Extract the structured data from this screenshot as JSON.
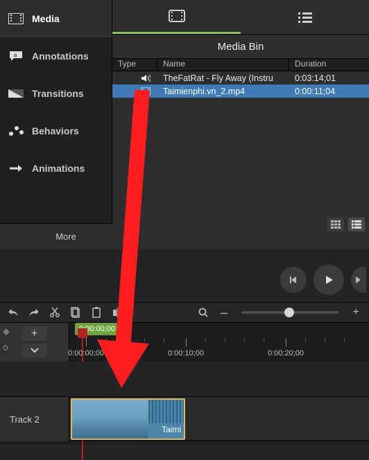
{
  "sidebar": {
    "items": [
      {
        "label": "Media"
      },
      {
        "label": "Annotations"
      },
      {
        "label": "Transitions"
      },
      {
        "label": "Behaviors"
      },
      {
        "label": "Animations"
      }
    ],
    "more_label": "More"
  },
  "media_bin": {
    "title": "Media Bin",
    "columns": {
      "type": "Type",
      "name": "Name",
      "duration": "Duration"
    },
    "rows": [
      {
        "type": "audio",
        "name": "TheFatRat - Fly Away (Instru",
        "duration": "0:03:14;01",
        "selected": false
      },
      {
        "type": "video",
        "name": "Taimienphi.vn_2.mp4",
        "duration": "0:00:11;04",
        "selected": true
      }
    ]
  },
  "playhead": {
    "time": "0:00:00;00"
  },
  "ruler": {
    "labels": [
      {
        "pos": 24,
        "text": "0:00:00;00"
      },
      {
        "pos": 168,
        "text": "0:00:10;00"
      },
      {
        "pos": 312,
        "text": "0:00:20;00"
      }
    ]
  },
  "tracks": {
    "track2": {
      "label": "Track 2",
      "clip_label": "Taimi"
    }
  },
  "toolbar": {
    "zoom_minus": "–",
    "zoom_plus": "+"
  }
}
